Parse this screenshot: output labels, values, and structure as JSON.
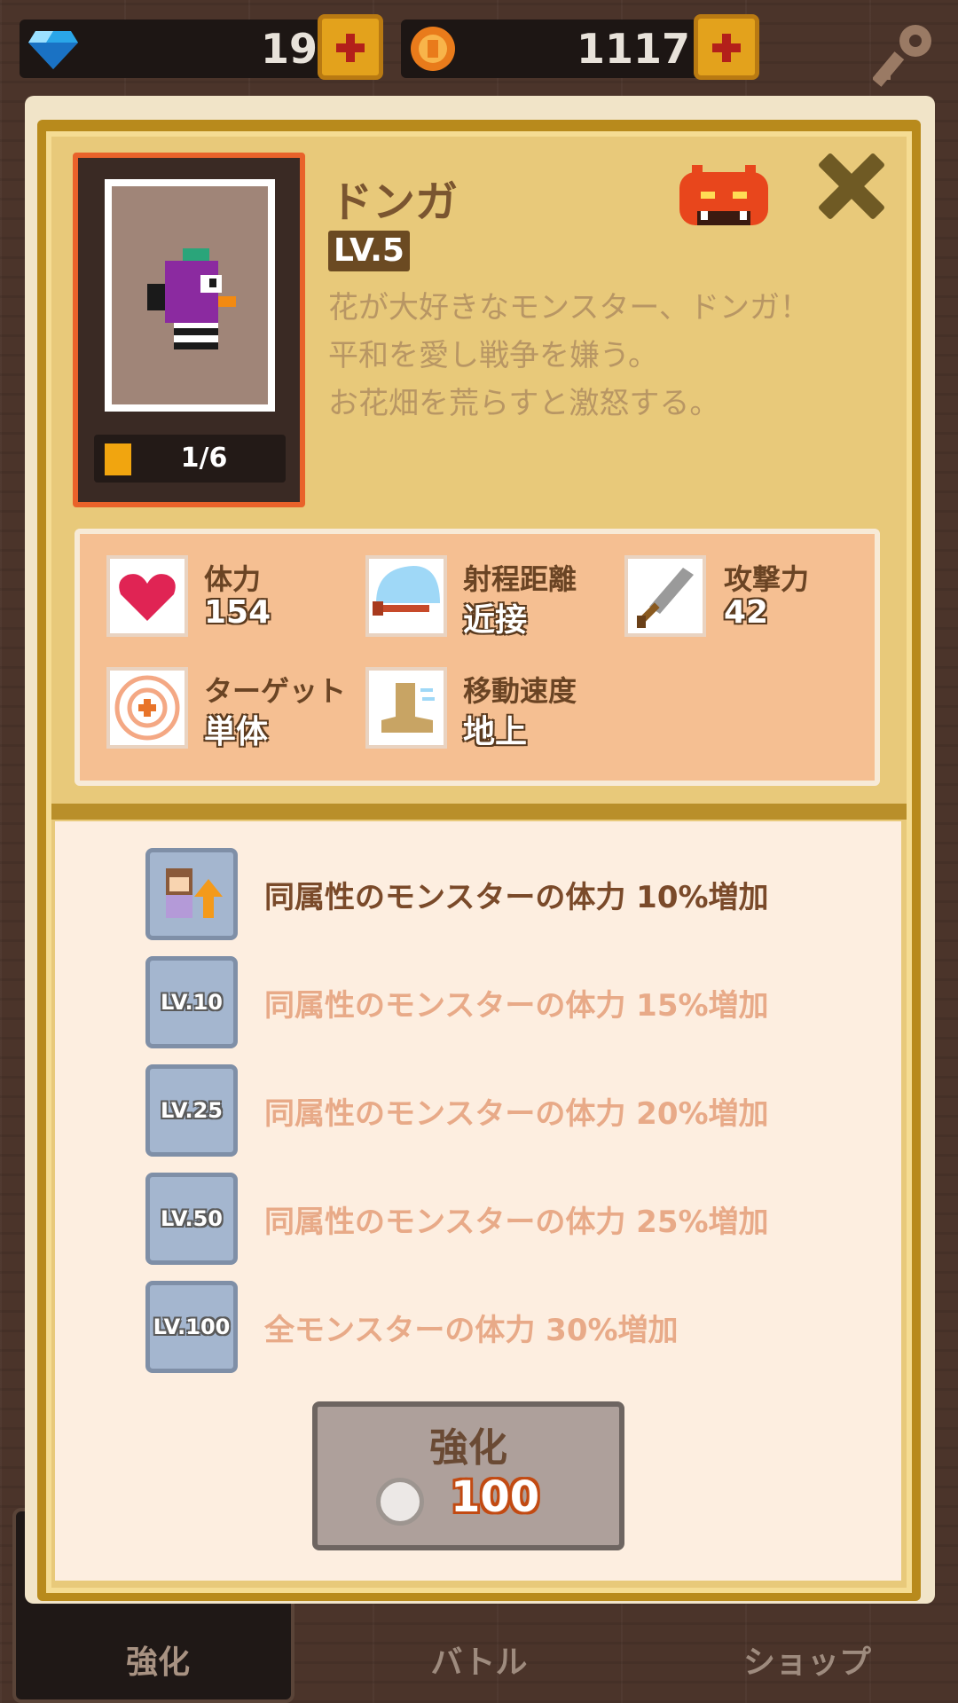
{
  "currency": {
    "gems": "19",
    "coins": "1117"
  },
  "monster": {
    "name": "ドンガ",
    "level": "LV.5",
    "description": [
      "花が大好きなモンスター、ドンガ！",
      "平和を愛し戦争を嫌う。",
      "お花畑を荒らすと激怒する。"
    ],
    "card_count": "1/6",
    "element_color": "#e8461c"
  },
  "stats": [
    {
      "name": "体力",
      "value": "154",
      "icon": "heart-icon"
    },
    {
      "name": "射程距離",
      "value": "近接",
      "icon": "range-icon"
    },
    {
      "name": "攻撃力",
      "value": "42",
      "icon": "sword-icon"
    },
    {
      "name": "ターゲット",
      "value": "単体",
      "icon": "target-icon"
    },
    {
      "name": "移動速度",
      "value": "地上",
      "icon": "boot-icon"
    }
  ],
  "skills": [
    {
      "level": "",
      "text": "同属性のモンスターの体力 10%増加",
      "unlocked": true
    },
    {
      "level": "LV.10",
      "text": "同属性のモンスターの体力 15%増加",
      "unlocked": false
    },
    {
      "level": "LV.25",
      "text": "同属性のモンスターの体力 20%増加",
      "unlocked": false
    },
    {
      "level": "LV.50",
      "text": "同属性のモンスターの体力 25%増加",
      "unlocked": false
    },
    {
      "level": "LV.100",
      "text": "全モンスターの体力 30%増加",
      "unlocked": false
    }
  ],
  "upgrade": {
    "label": "強化",
    "cost": "100"
  },
  "tabs": [
    {
      "label": "強化",
      "active": true
    },
    {
      "label": "バトル",
      "active": false
    },
    {
      "label": "ショップ",
      "active": false
    }
  ],
  "colors": {
    "unlocked_text": "#7a4a2a",
    "locked_text": "#e8aa88"
  }
}
